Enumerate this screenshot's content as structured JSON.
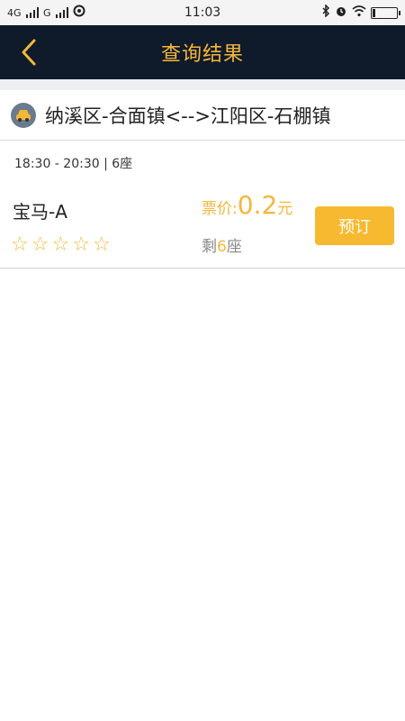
{
  "status_bar": {
    "network1": "4G",
    "network2": "G",
    "time": "11:03"
  },
  "nav": {
    "title": "查询结果"
  },
  "route": {
    "text": "纳溪区-合面镇<-->江阳区-石棚镇"
  },
  "trip": {
    "time_seats": "18:30 - 20:30 | 6座",
    "car_name": "宝马-A",
    "rating": 0,
    "rating_max": 5,
    "price_label": "票价:",
    "price_value": "0.2",
    "price_unit": "元",
    "remaining_prefix": "剩",
    "remaining_count": "6",
    "remaining_suffix": "座",
    "book_label": "预订"
  },
  "colors": {
    "accent": "#f4b73a",
    "nav_bg": "#0f1a2a",
    "button_bg": "#f7b92f"
  },
  "icons": {
    "back": "chevron-left-icon",
    "car": "taxi-icon",
    "star": "star-outline-icon"
  }
}
